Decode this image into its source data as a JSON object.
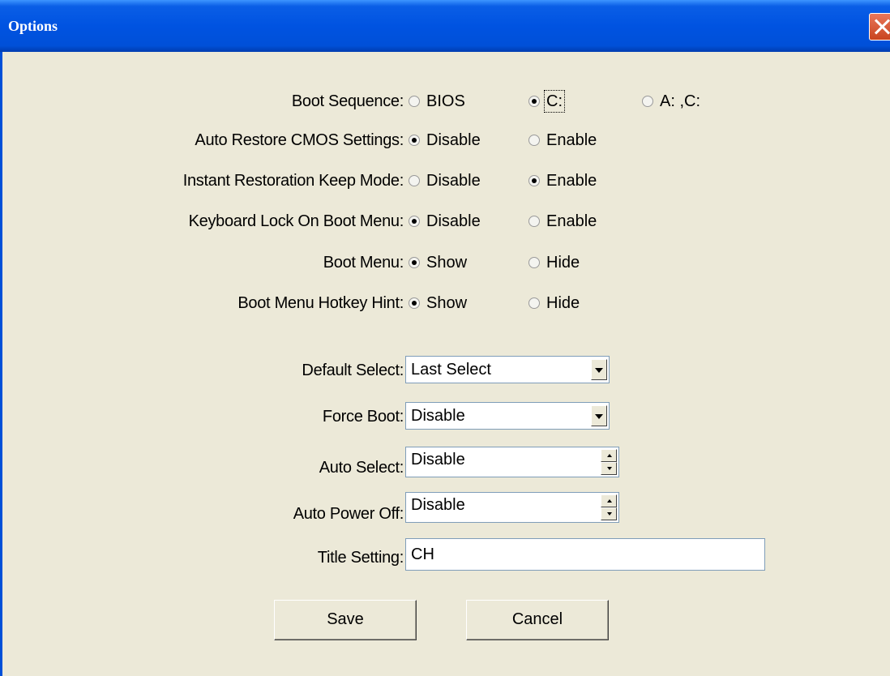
{
  "window": {
    "title": "Options",
    "close_icon": "close-icon"
  },
  "radio_rows": [
    {
      "label": "Boot Sequence:",
      "options": [
        "BIOS",
        "C:",
        "A: ,C:"
      ],
      "selected": 1
    },
    {
      "label": "Auto Restore CMOS Settings:",
      "options": [
        "Disable",
        "Enable"
      ],
      "selected": 0
    },
    {
      "label": "Instant Restoration Keep Mode:",
      "options": [
        "Disable",
        "Enable"
      ],
      "selected": 1
    },
    {
      "label": "Keyboard Lock On Boot Menu:",
      "options": [
        "Disable",
        "Enable"
      ],
      "selected": 0
    },
    {
      "label": "Boot Menu:",
      "options": [
        "Show",
        "Hide"
      ],
      "selected": 0
    },
    {
      "label": "Boot Menu Hotkey Hint:",
      "options": [
        "Show",
        "Hide"
      ],
      "selected": 0
    }
  ],
  "default_select": {
    "label": "Default Select:",
    "value": "Last Select"
  },
  "force_boot": {
    "label": "Force Boot:",
    "value": "Disable"
  },
  "auto_select": {
    "label": "Auto Select:",
    "value": "Disable"
  },
  "auto_power_off": {
    "label": "Auto Power Off:",
    "value": "Disable"
  },
  "title_setting": {
    "label": "Title Setting:",
    "value": "CH"
  },
  "buttons": {
    "save": "Save",
    "cancel": "Cancel"
  },
  "colors": {
    "dialog_bg": "#ece9d8",
    "titlebar": "#0053e1",
    "close": "#d9542b"
  }
}
